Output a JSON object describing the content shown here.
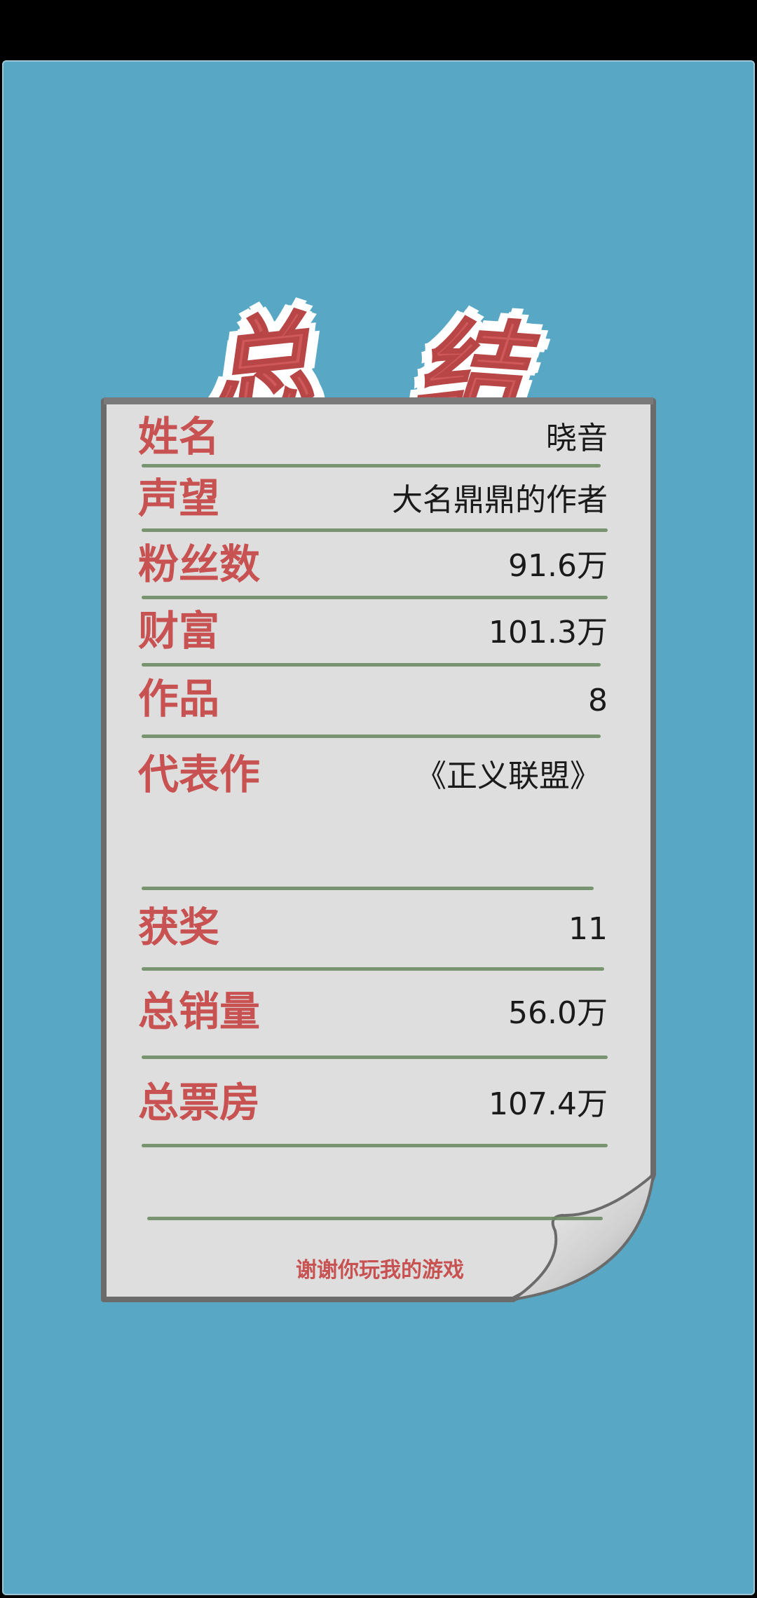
{
  "title": {
    "char1": "总",
    "char2": "结"
  },
  "rows": [
    {
      "label": "姓名",
      "value": "晓音"
    },
    {
      "label": "声望",
      "value": "大名鼎鼎的作者"
    },
    {
      "label": "粉丝数",
      "value": "91.6万"
    },
    {
      "label": "财富",
      "value": "101.3万"
    },
    {
      "label": "作品",
      "value": "8"
    },
    {
      "label": "代表作",
      "value": "《正义联盟》"
    },
    {
      "label": "获奖",
      "value": "11"
    },
    {
      "label": "总销量",
      "value": "56.0万"
    },
    {
      "label": "总票房",
      "value": "107.4万"
    }
  ],
  "footer": {
    "thanks": "谢谢你玩我的游戏"
  },
  "colors": {
    "background": "#58a8c5",
    "label": "#c85252",
    "value": "#1a1a1a",
    "rule": "#6d8c64",
    "paper": "#dcdcdc"
  }
}
